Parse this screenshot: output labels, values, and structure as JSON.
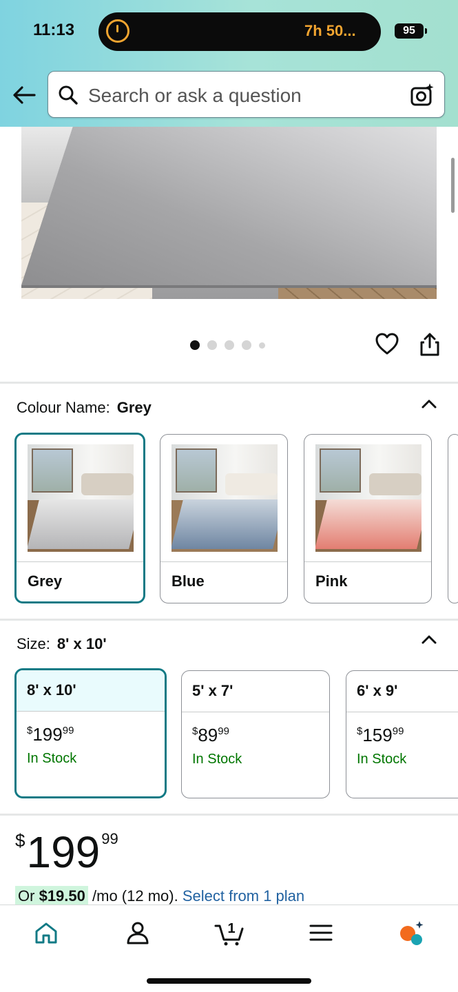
{
  "status_bar": {
    "time": "11:13",
    "live_activity": "7h 50...",
    "battery": "95"
  },
  "search": {
    "placeholder": "Search or ask a question"
  },
  "gallery": {
    "total_images": 5,
    "active_index": 0
  },
  "colour": {
    "label": "Colour Name:",
    "selected": "Grey",
    "options": [
      "Grey",
      "Blue",
      "Pink"
    ]
  },
  "size": {
    "label": "Size:",
    "selected": "8' x 10'",
    "options": [
      {
        "name": "8' x 10'",
        "price_symbol": "$",
        "price_whole": "199",
        "price_fraction": "99",
        "stock": "In Stock"
      },
      {
        "name": "5' x 7'",
        "price_symbol": "$",
        "price_whole": "89",
        "price_fraction": "99",
        "stock": "In Stock"
      },
      {
        "name": "6' x 9'",
        "price_symbol": "$",
        "price_whole": "159",
        "price_fraction": "99",
        "stock": "In Stock"
      }
    ]
  },
  "price": {
    "symbol": "$",
    "whole": "199",
    "fraction": "99"
  },
  "installment": {
    "prefix": "Or",
    "amount": "$19.50",
    "terms": "/mo (12 mo).",
    "link": "Select from 1 plan"
  },
  "colors": {
    "header_gradient_start": "#7fd3e0",
    "accent_teal": "#117a85",
    "in_stock_green": "#007600",
    "link_blue": "#2162a1",
    "live_activity_orange": "#f3a530"
  },
  "icons": {
    "back": "arrow-left-icon",
    "search": "search-icon",
    "camera": "camera-search-icon",
    "wishlist": "heart-icon",
    "share": "share-icon",
    "collapse": "chevron-up-icon",
    "nav": [
      "home-icon",
      "account-icon",
      "cart-icon",
      "menu-icon",
      "rufus-icon"
    ]
  },
  "cart": {
    "count": "1"
  }
}
